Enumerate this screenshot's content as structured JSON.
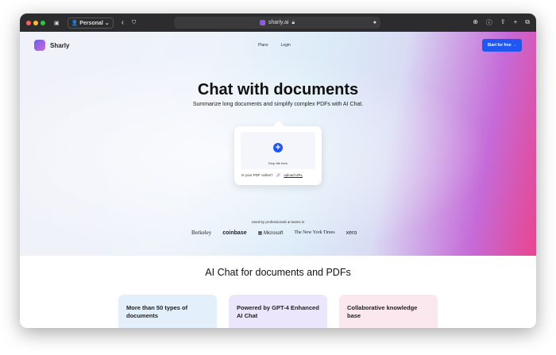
{
  "browser": {
    "profile": "Personal",
    "url": "sharly.ai"
  },
  "nav": {
    "brand": "Sharly",
    "links": [
      "Plans",
      "Login"
    ],
    "cta": "Start for free →"
  },
  "hero": {
    "title": "Chat with documents",
    "subtitle": "Summarize long documents and simplify complex PDFs with AI Chat.",
    "drop_label": "Drop file here",
    "online_prompt": "Is your PDF online?",
    "upload_url": "upload URL"
  },
  "social": {
    "label": "Used by professionals & teams in",
    "logos": [
      "Berkeley",
      "coinbase",
      "Microsoft",
      "The New York Times",
      "xero"
    ]
  },
  "section": {
    "title": "AI Chat for documents and PDFs"
  },
  "features": [
    {
      "title": "More than 50 types of documents",
      "color": "#e3effb"
    },
    {
      "title": "Powered by GPT-4 Enhanced AI Chat",
      "color": "#ebe6fb"
    },
    {
      "title": "Collaborative knowledge base",
      "color": "#fbe8ee"
    }
  ]
}
